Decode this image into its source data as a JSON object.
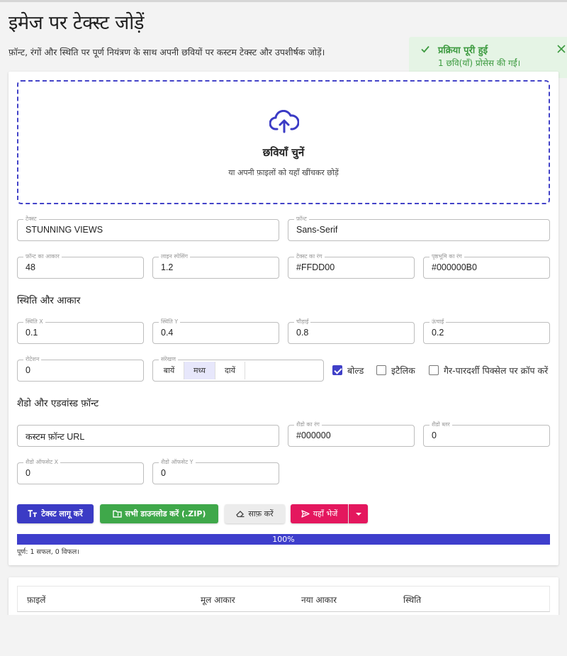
{
  "page": {
    "title": "इमेज पर टेक्स्ट जोड़ें",
    "subtitle": "फ़ॉन्ट, रंगों और स्थिति पर पूर्ण नियंत्रण के साथ अपनी छवियों पर कस्टम टेक्स्ट और उपशीर्षक जोड़ें।"
  },
  "toast": {
    "title": "प्रक्रिया पूरी हुई",
    "message": "1 छवि(याँ) प्रोसेस की गईं।",
    "color": "#3c9a3f"
  },
  "dropzone": {
    "title": "छवियाँ चुनें",
    "hint": "या अपनी फ़ाइलों को यहाँ खींचकर छोड़ें"
  },
  "fields": {
    "text": {
      "label": "टेक्स्ट",
      "value": "STUNNING VIEWS"
    },
    "font": {
      "label": "फ़ॉन्ट",
      "value": "Sans-Serif"
    },
    "font_size": {
      "label": "फ़ॉन्ट का आकार",
      "value": "48"
    },
    "line_spacing": {
      "label": "लाइन स्पेसिंग",
      "value": "1.2"
    },
    "text_color": {
      "label": "टेक्स्ट का रंग",
      "value": "#FFDD00"
    },
    "bg_color": {
      "label": "पृष्ठभूमि का रंग",
      "value": "#000000B0"
    },
    "pos_x": {
      "label": "स्थिति X",
      "value": "0.1"
    },
    "pos_y": {
      "label": "स्थिति Y",
      "value": "0.4"
    },
    "width": {
      "label": "चौड़ाई",
      "value": "0.8"
    },
    "height": {
      "label": "ऊंचाई",
      "value": "0.2"
    },
    "rotation": {
      "label": "रोटेशन",
      "value": "0"
    },
    "custom_font_url": {
      "value": "कस्टम फ़ॉन्ट URL"
    },
    "shadow_color": {
      "label": "शैडो का रंग",
      "value": "#000000"
    },
    "shadow_blur": {
      "label": "शैडो ब्लर",
      "value": "0"
    },
    "shadow_offset_x": {
      "label": "शैडो ऑफसेट X",
      "value": "0"
    },
    "shadow_offset_y": {
      "label": "शैडो ऑफसेट Y",
      "value": "0"
    }
  },
  "sections": {
    "position": "स्थिति और आकार",
    "shadow": "शैडो और एडवांस्ड फ़ॉन्ट"
  },
  "alignment": {
    "label": "संरेखण",
    "options": [
      "बायें",
      "मध्य",
      "दायें"
    ],
    "selected": "मध्य"
  },
  "checkboxes": {
    "bold": {
      "label": "बोल्ड",
      "checked": true
    },
    "italic": {
      "label": "इटैलिक",
      "checked": false
    },
    "crop": {
      "label": "गैर-पारदर्शी पिक्सेल पर क्रॉप करें",
      "checked": false
    }
  },
  "buttons": {
    "apply": "टेक्स्ट लागू करें",
    "download_zip": "सभी डाउनलोड करें (.ZIP)",
    "clear": "साफ़ करें",
    "send": "यहाँ भेजें"
  },
  "progress": {
    "value": 100,
    "label": "100%",
    "status": "पूर्ण: 1 सफल, 0 विफल।"
  },
  "table": {
    "columns": [
      "फ़ाइलें",
      "मूल आकार",
      "नया आकार",
      "स्थिति"
    ]
  },
  "colors": {
    "accent": "#3b3bc5",
    "success": "#3fa84a",
    "send": "#e4175e"
  }
}
